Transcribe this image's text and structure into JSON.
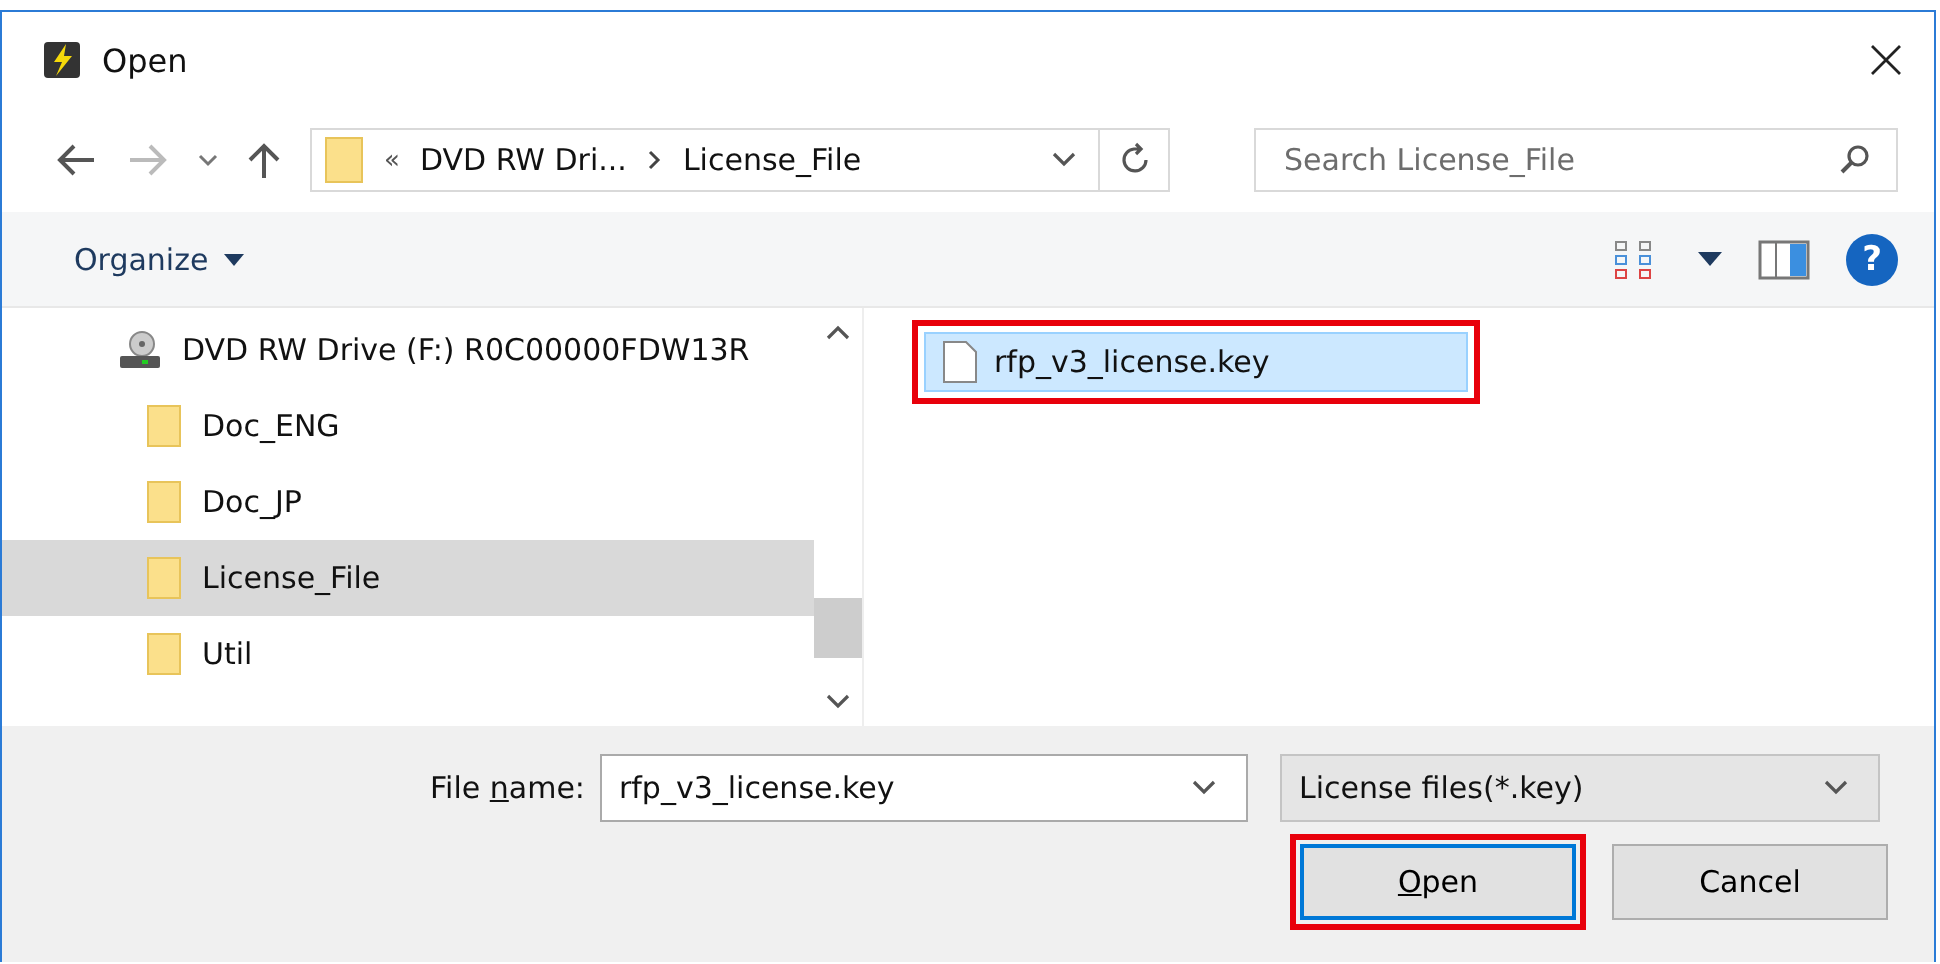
{
  "window": {
    "title": "Open"
  },
  "address_bar": {
    "overflow": "«",
    "segments": [
      "DVD RW Dri...",
      "License_File"
    ]
  },
  "search": {
    "placeholder": "Search License_File"
  },
  "toolbar": {
    "organize": "Organize",
    "help": "?"
  },
  "tree": {
    "items": [
      {
        "kind": "drive",
        "label": "DVD RW Drive (F:) R0C00000FDW13R",
        "selected": false
      },
      {
        "kind": "folder",
        "label": "Doc_ENG",
        "selected": false
      },
      {
        "kind": "folder",
        "label": "Doc_JP",
        "selected": false
      },
      {
        "kind": "folder",
        "label": "License_File",
        "selected": true
      },
      {
        "kind": "folder",
        "label": "Util",
        "selected": false
      }
    ]
  },
  "files": [
    {
      "name": "rfp_v3_license.key",
      "selected": true,
      "highlighted": true
    }
  ],
  "file_name": {
    "label_before": "File ",
    "access_key": "n",
    "label_after": "ame:",
    "value": "rfp_v3_license.key"
  },
  "file_type": {
    "value": "License files(*.key)"
  },
  "buttons": [
    {
      "access_key": "O",
      "label_after": "pen",
      "default": true,
      "highlighted": true
    },
    {
      "label": "Cancel",
      "default": false,
      "highlighted": false
    }
  ]
}
